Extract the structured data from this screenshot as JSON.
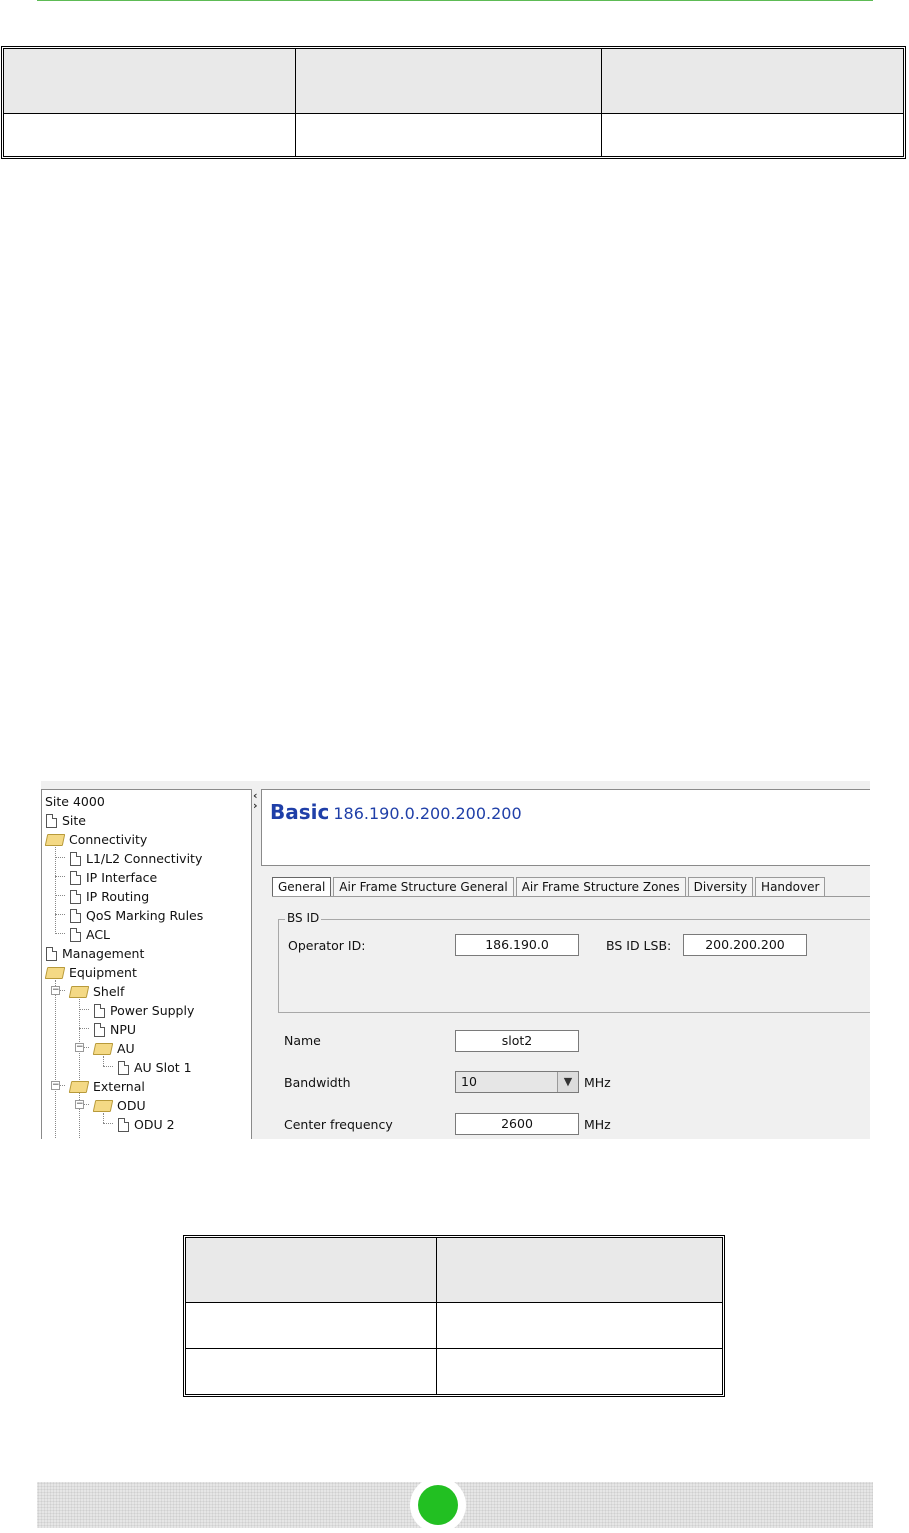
{
  "screenshot": {
    "tree": {
      "items": [
        {
          "label": "Site 4000",
          "icon": "none"
        },
        {
          "label": "Site",
          "icon": "document-icon"
        },
        {
          "label": "Connectivity",
          "icon": "folder-open-icon"
        },
        {
          "label": "L1/L2 Connectivity",
          "icon": "document-icon"
        },
        {
          "label": "IP Interface",
          "icon": "document-icon"
        },
        {
          "label": "IP Routing",
          "icon": "document-icon"
        },
        {
          "label": "QoS Marking Rules",
          "icon": "document-icon"
        },
        {
          "label": "ACL",
          "icon": "document-icon"
        },
        {
          "label": "Management",
          "icon": "document-icon"
        },
        {
          "label": "Equipment",
          "icon": "folder-open-icon"
        },
        {
          "label": "Shelf",
          "icon": "folder-open-icon"
        },
        {
          "label": "Power Supply",
          "icon": "document-icon"
        },
        {
          "label": "NPU",
          "icon": "document-icon"
        },
        {
          "label": "AU",
          "icon": "folder-open-icon"
        },
        {
          "label": "AU Slot 1",
          "icon": "document-icon"
        },
        {
          "label": "External",
          "icon": "folder-open-icon"
        },
        {
          "label": "ODU",
          "icon": "folder-open-icon"
        },
        {
          "label": "ODU 2",
          "icon": "document-icon"
        }
      ]
    },
    "header": {
      "title": "Basic",
      "subtitle": "186.190.0.200.200.200"
    },
    "tabs": [
      {
        "label": "General",
        "active": true
      },
      {
        "label": "Air Frame Structure General",
        "active": false
      },
      {
        "label": "Air Frame Structure Zones",
        "active": false
      },
      {
        "label": "Diversity",
        "active": false
      },
      {
        "label": "Handover",
        "active": false
      }
    ],
    "bs_id": {
      "legend": "BS ID",
      "operator_id_label": "Operator ID:",
      "operator_id_value": "186.190.0",
      "bs_id_lsb_label": "BS ID LSB:",
      "bs_id_lsb_value": "200.200.200"
    },
    "form": {
      "name_label": "Name",
      "name_value": "slot2",
      "bandwidth_label": "Bandwidth",
      "bandwidth_value": "10",
      "bandwidth_unit": "MHz",
      "center_frequency_label": "Center frequency",
      "center_frequency_value": "2600",
      "center_frequency_unit": "MHz"
    }
  },
  "colors": {
    "accent_green": "#22c022",
    "top_rule": "#5dbb55",
    "header_title": "#1f3fa8",
    "table_header_fill": "#e9e9e9"
  }
}
